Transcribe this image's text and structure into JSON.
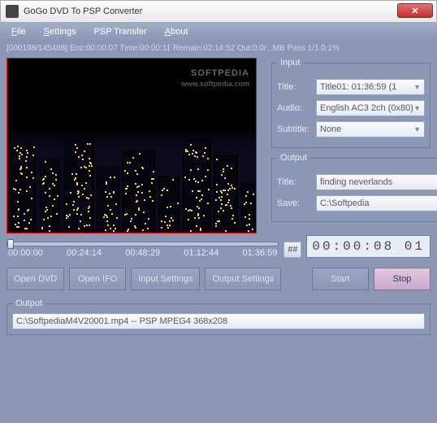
{
  "window": {
    "title": "GoGo DVD To PSP Converter"
  },
  "menu": {
    "file": "File",
    "settings": "Settings",
    "psp": "PSP Transfer",
    "about": "About"
  },
  "status": "[000198/145488] Enc:00:00:07 Time:00:00:11 Remain:02:14:52 Out:0.0/...MB Pass 1/1 0.1%",
  "watermark": {
    "text": "SOFTPEDIA",
    "sub": "www.softpedia.com"
  },
  "input": {
    "legend": "Input",
    "title_label": "Title:",
    "title_value": "Title01: 01:36:59     (1",
    "audio_label": "Audio:",
    "audio_value": "English AC3 2ch (0x80)",
    "subtitle_label": "Subtitle:",
    "subtitle_value": "None"
  },
  "output": {
    "legend": "Output",
    "title_label": "Title:",
    "title_value": "finding neverlands",
    "save_label": "Save:",
    "save_value": "C:\\Softpedia",
    "browse": "..."
  },
  "ticks": {
    "t0": "00:00:00",
    "t1": "00:24:14",
    "t2": "00:48:29",
    "t3": "01:12:44",
    "t4": "01:36:59"
  },
  "hash": "##",
  "timecode": "00:00:08 01",
  "buttons": {
    "open_dvd": "Open DVD",
    "open_ifo": "Open IFO",
    "input_settings": "Input Settings",
    "output_settings": "Output Settings",
    "start": "Start",
    "stop": "Stop"
  },
  "out_section": {
    "legend": "Output",
    "path": "C:\\SoftpediaM4V20001.mp4 -- PSP MPEG4 368x208"
  }
}
